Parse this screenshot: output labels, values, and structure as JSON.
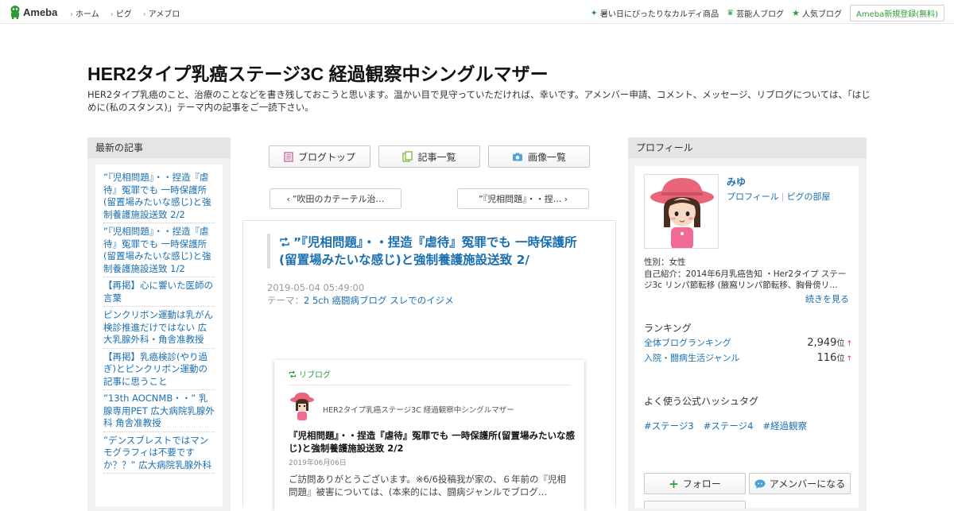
{
  "topbar": {
    "logo_text": "Ameba",
    "nav": [
      "ホーム",
      "ピグ",
      "アメブロ"
    ],
    "promo_link": "暑い日にぴったりなカルディ商品",
    "celebrity_link": "芸能人ブログ",
    "popular_link": "人気ブログ",
    "register_label": "Ameba新規登録(無料)"
  },
  "header": {
    "title": "HER2タイプ乳癌ステージ3C 経過観察中シングルマザー",
    "description": "HER2タイプ乳癌のこと、治療のことなどを書き残しておこうと思います。温かい目で見守っていただければ、幸いです。アメンバー申請、コメント、メッセージ、リブログについては、「はじめに(私のスタンス)」テーマ内の記事をご一読下さい。"
  },
  "sidebar_left": {
    "heading": "最新の記事",
    "items": [
      "”『児相問題』・・捏造『虐待』冤罪でも 一時保護所(留置場みたいな感じ)と強制養護施設送致 2/2",
      "”『児相問題』・・捏造『虐待』冤罪でも 一時保護所(留置場みたいな感じ)と強制養護施設送致 1/2",
      "【再掲】心に響いた医師の言葉",
      "ピンクリボン運動は乳がん検診推進だけではない 広大乳腺外科・角舎准教授",
      "【再掲】乳癌検診(やり過ぎ)とピンクリボン運動の記事に思うこと",
      "”13th AOCNMB・・” 乳腺専用PET 広大病院乳腺外科 角舎准教授",
      "”デンスブレストではマンモグラフィは不要ですか？？” 広大病院乳腺外科"
    ]
  },
  "center": {
    "buttons": [
      "ブログトップ",
      "記事一覧",
      "画像一覧"
    ],
    "prev_link": "”吹田のカテーテル治…",
    "next_link": "”『児相問題』・・捏…",
    "article": {
      "title": "”『児相問題』・・捏造『虐待』冤罪でも 一時保護所(留置場みたいな感じ)と強制養護施設送致 2/",
      "date": "2019-05-04 05:49:00",
      "theme_label": "テーマ：",
      "theme": "2 5ch 癌闘病ブログ スレでのイジメ"
    },
    "reblog": {
      "label": "リブログ",
      "blog_name": "HER2タイプ乳癌ステージ3C 経過観察中シングルマザー",
      "title": "『児相問題』・・捏造『虐待』冤罪でも 一時保護所(留置場みたいな感じ)と強制養護施設送致 2/2",
      "date": "2019年06月06日",
      "excerpt": "ご訪問ありがとうございます。※6/6投稿我が家の、６年前の『児相問題』被害については、(本来的には、闘病ジャンルでブログ…"
    }
  },
  "sidebar_right": {
    "heading": "プロフィール",
    "name": "みゆ",
    "profile_link": "プロフィール",
    "pig_link": "ピグの部屋",
    "gender": "性別：女性",
    "intro": "自己紹介：2014年6月乳癌告知 ・Her2タイプ ステージ3c リンパ節転移 (腋窩リンパ節転移、胸骨傍リ…",
    "more_label": "続きを見る",
    "ranking_heading": "ランキング",
    "rankings": [
      {
        "name": "全体ブログランキング",
        "value": "2,949",
        "unit": "位",
        "arrow": "↑"
      },
      {
        "name": "入院・闘病生活ジャンル",
        "value": "116",
        "unit": "位",
        "arrow": "↑"
      }
    ],
    "hashtag_heading": "よく使う公式ハッシュタグ",
    "hashtags": [
      "#ステージ3",
      "#ステージ4",
      "#経過観察"
    ],
    "follow_label": "フォロー",
    "amember_label": "アメンバーになる"
  }
}
